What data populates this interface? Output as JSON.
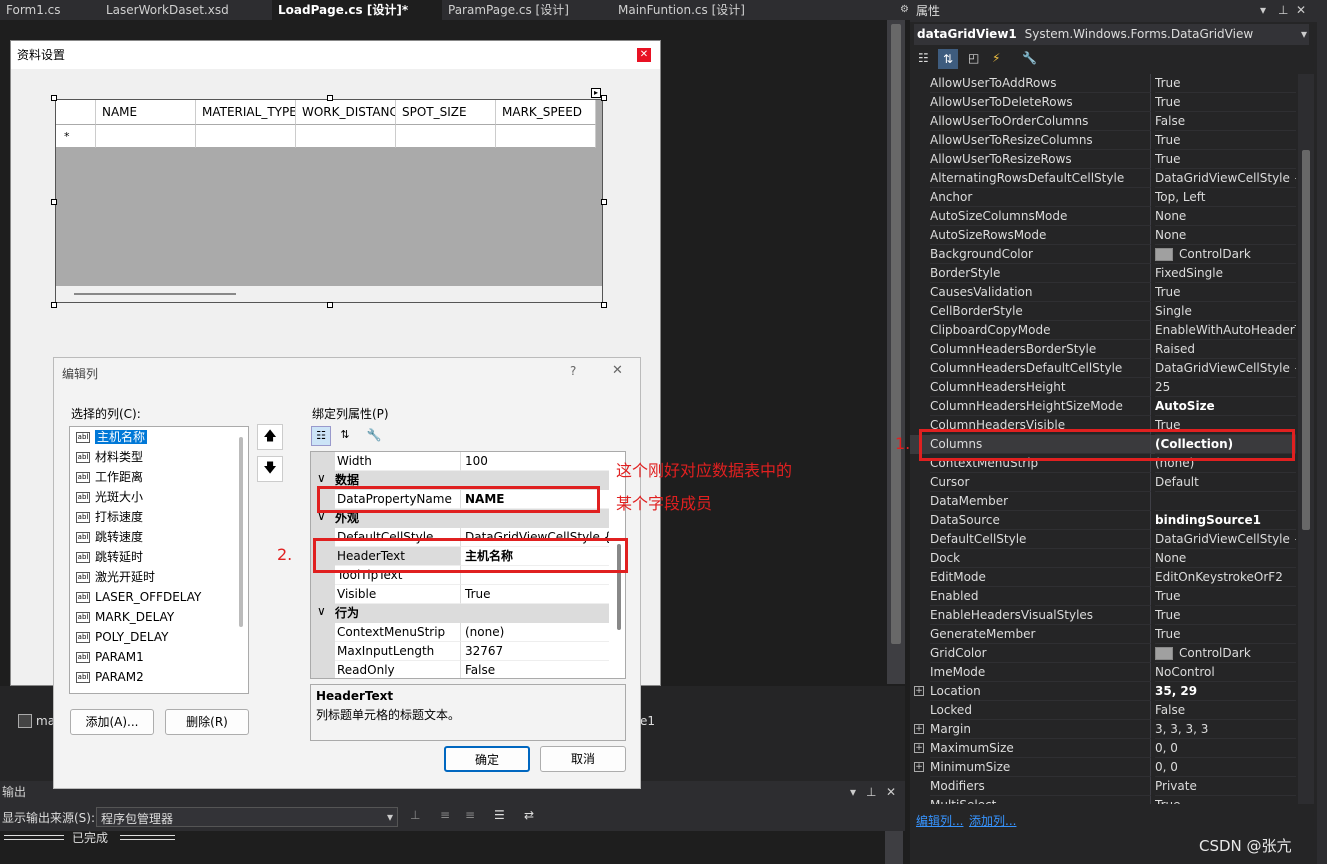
{
  "tabs": [
    "Form1.cs",
    "LaserWorkDaset.xsd",
    "LoadPage.cs [设计]*",
    "ParamPage.cs [设计]",
    "MainFuntion.cs [设计]"
  ],
  "form": {
    "title": "资料设置",
    "columns": [
      "NAME",
      "MATERIAL_TYPE",
      "WORK_DISTANC",
      "SPOT_SIZE",
      "MARK_SPEED"
    ],
    "new_row_marker": "*"
  },
  "bottom_strip": {
    "left_text": "ma",
    "right_text": "e1"
  },
  "output": {
    "title": "输出",
    "source_label": "显示输出来源(S):",
    "source_value": "程序包管理器",
    "status": "已完成"
  },
  "dialog": {
    "title": "编辑列",
    "help": "?",
    "selected_columns_label": "选择的列(C):",
    "columns": [
      "主机名称",
      "材料类型",
      "工作距离",
      "光斑大小",
      "打标速度",
      "跳转速度",
      "跳转延时",
      "激光开延时",
      "LASER_OFFDELAY",
      "MARK_DELAY",
      "POLY_DELAY",
      "PARAM1",
      "PARAM2"
    ],
    "add_button": "添加(A)...",
    "remove_button": "删除(R)",
    "bound_props_label": "绑定列属性(P)",
    "props": [
      {
        "type": "row",
        "name": "Width",
        "value": "100"
      },
      {
        "type": "cat",
        "name": "数据"
      },
      {
        "type": "row",
        "name": "DataPropertyName",
        "value": "NAME",
        "bold": true
      },
      {
        "type": "cat",
        "name": "外观"
      },
      {
        "type": "row",
        "name": "DefaultCellStyle",
        "value": "DataGridViewCellStyle { }"
      },
      {
        "type": "row",
        "name": "HeaderText",
        "value": "主机名称",
        "bold": true
      },
      {
        "type": "row",
        "name": "ToolTipText",
        "value": ""
      },
      {
        "type": "row",
        "name": "Visible",
        "value": "True"
      },
      {
        "type": "cat",
        "name": "行为"
      },
      {
        "type": "row",
        "name": "ContextMenuStrip",
        "value": "(none)"
      },
      {
        "type": "row",
        "name": "MaxInputLength",
        "value": "32767"
      },
      {
        "type": "row",
        "name": "ReadOnly",
        "value": "False"
      }
    ],
    "desc_title": "HeaderText",
    "desc_text": "列标题单元格的标题文本。",
    "ok_button": "确定",
    "cancel_button": "取消"
  },
  "annotations": {
    "num1": "1.",
    "num2": "2.",
    "note_line1": "这个刚好对应数据表中的",
    "note_line2": "某个字段成员"
  },
  "properties": {
    "panel_title": "属性",
    "object_name": "dataGridView1",
    "object_type": "System.Windows.Forms.DataGridView",
    "rows": [
      {
        "name": "AllowUserToAddRows",
        "value": "True"
      },
      {
        "name": "AllowUserToDeleteRows",
        "value": "True"
      },
      {
        "name": "AllowUserToOrderColumns",
        "value": "False"
      },
      {
        "name": "AllowUserToResizeColumns",
        "value": "True"
      },
      {
        "name": "AllowUserToResizeRows",
        "value": "True"
      },
      {
        "name": "AlternatingRowsDefaultCellStyle",
        "value": "DataGridViewCellStyle {"
      },
      {
        "name": "Anchor",
        "value": "Top, Left"
      },
      {
        "name": "AutoSizeColumnsMode",
        "value": "None"
      },
      {
        "name": "AutoSizeRowsMode",
        "value": "None"
      },
      {
        "name": "BackgroundColor",
        "value": "ControlDark",
        "swatch": "#a0a0a0"
      },
      {
        "name": "BorderStyle",
        "value": "FixedSingle"
      },
      {
        "name": "CausesValidation",
        "value": "True"
      },
      {
        "name": "CellBorderStyle",
        "value": "Single"
      },
      {
        "name": "ClipboardCopyMode",
        "value": "EnableWithAutoHeaderT"
      },
      {
        "name": "ColumnHeadersBorderStyle",
        "value": "Raised"
      },
      {
        "name": "ColumnHeadersDefaultCellStyle",
        "value": "DataGridViewCellStyle {"
      },
      {
        "name": "ColumnHeadersHeight",
        "value": "25"
      },
      {
        "name": "ColumnHeadersHeightSizeMode",
        "value": "AutoSize",
        "bold": true
      },
      {
        "name": "ColumnHeadersVisible",
        "value": "True"
      },
      {
        "name": "Columns",
        "value": "(Collection)",
        "bold": true
      },
      {
        "name": "ContextMenuStrip",
        "value": "(none)"
      },
      {
        "name": "Cursor",
        "value": "Default"
      },
      {
        "name": "DataMember",
        "value": ""
      },
      {
        "name": "DataSource",
        "value": "bindingSource1",
        "bold": true
      },
      {
        "name": "DefaultCellStyle",
        "value": "DataGridViewCellStyle {"
      },
      {
        "name": "Dock",
        "value": "None"
      },
      {
        "name": "EditMode",
        "value": "EditOnKeystrokeOrF2"
      },
      {
        "name": "Enabled",
        "value": "True"
      },
      {
        "name": "EnableHeadersVisualStyles",
        "value": "True"
      },
      {
        "name": "GenerateMember",
        "value": "True"
      },
      {
        "name": "GridColor",
        "value": "ControlDark",
        "swatch": "#a0a0a0"
      },
      {
        "name": "ImeMode",
        "value": "NoControl"
      },
      {
        "name": "Location",
        "value": "35, 29",
        "bold": true,
        "expand": true
      },
      {
        "name": "Locked",
        "value": "False"
      },
      {
        "name": "Margin",
        "value": "3, 3, 3, 3",
        "expand": true
      },
      {
        "name": "MaximumSize",
        "value": "0, 0",
        "expand": true
      },
      {
        "name": "MinimumSize",
        "value": "0, 0",
        "expand": true
      },
      {
        "name": "Modifiers",
        "value": "Private"
      },
      {
        "name": "MultiSelect",
        "value": "True"
      }
    ],
    "link_edit_columns": "编辑列...",
    "link_add_column": "添加列...",
    "watermark": "CSDN @张亢"
  }
}
